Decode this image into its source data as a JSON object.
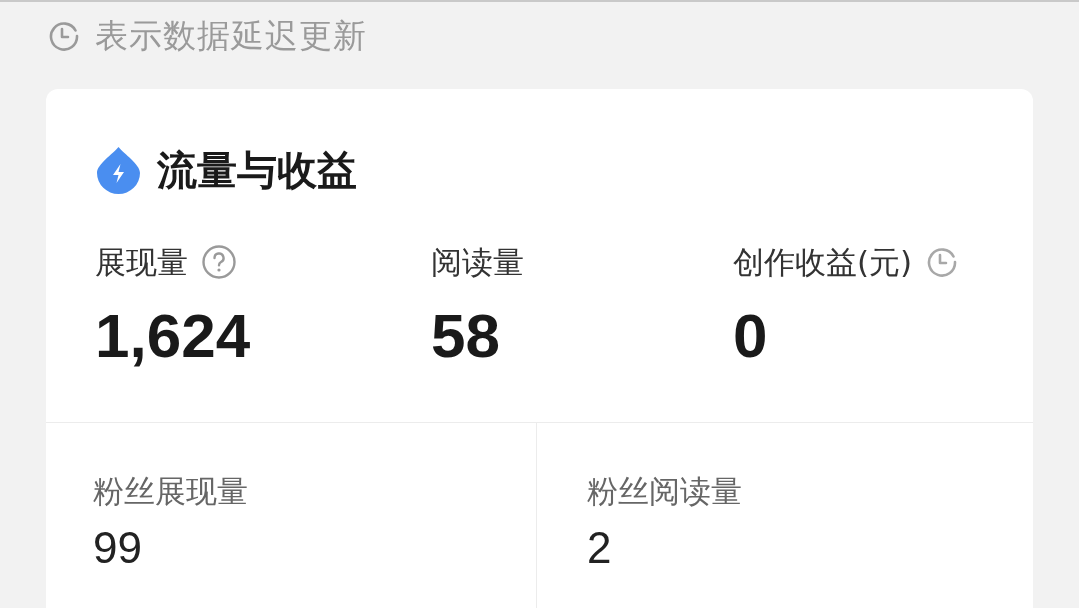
{
  "notice": {
    "text": "表示数据延迟更新"
  },
  "card": {
    "title": "流量与收益",
    "metrics": [
      {
        "kind": "help",
        "label": "展现量",
        "value": "1,624"
      },
      {
        "kind": "plain",
        "label": "阅读量",
        "value": "58"
      },
      {
        "kind": "delayed",
        "label": "创作收益(元)",
        "value": "0"
      }
    ],
    "fan_metrics": [
      {
        "label": "粉丝展现量",
        "value": "99"
      },
      {
        "label": "粉丝阅读量",
        "value": "2"
      }
    ]
  }
}
